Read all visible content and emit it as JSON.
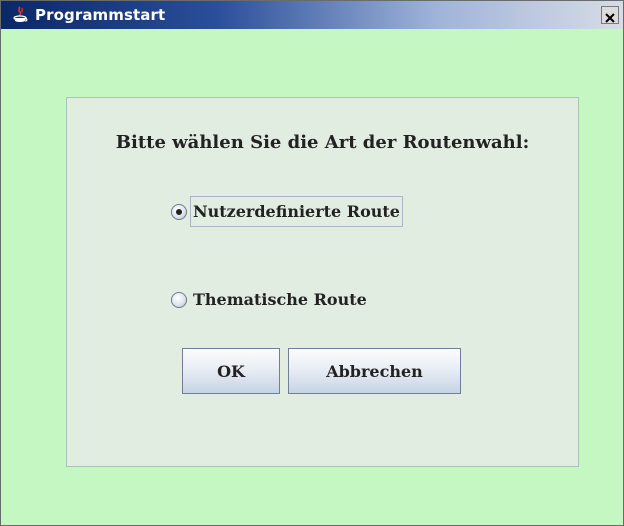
{
  "window": {
    "title": "Programmstart",
    "close_symbol": "×",
    "icon": "java-app-icon"
  },
  "dialog": {
    "prompt": "Bitte wählen Sie die Art der Routenwahl:",
    "options": [
      {
        "label": "Nutzerdefinierte Route",
        "selected": true
      },
      {
        "label": "Thematische Route",
        "selected": false
      }
    ],
    "ok_label": "OK",
    "cancel_label": "Abbrechen"
  },
  "colors": {
    "window_background": "#c4f7c1",
    "panel_background": "#e1ede0",
    "titlebar_start": "#0b2766"
  }
}
